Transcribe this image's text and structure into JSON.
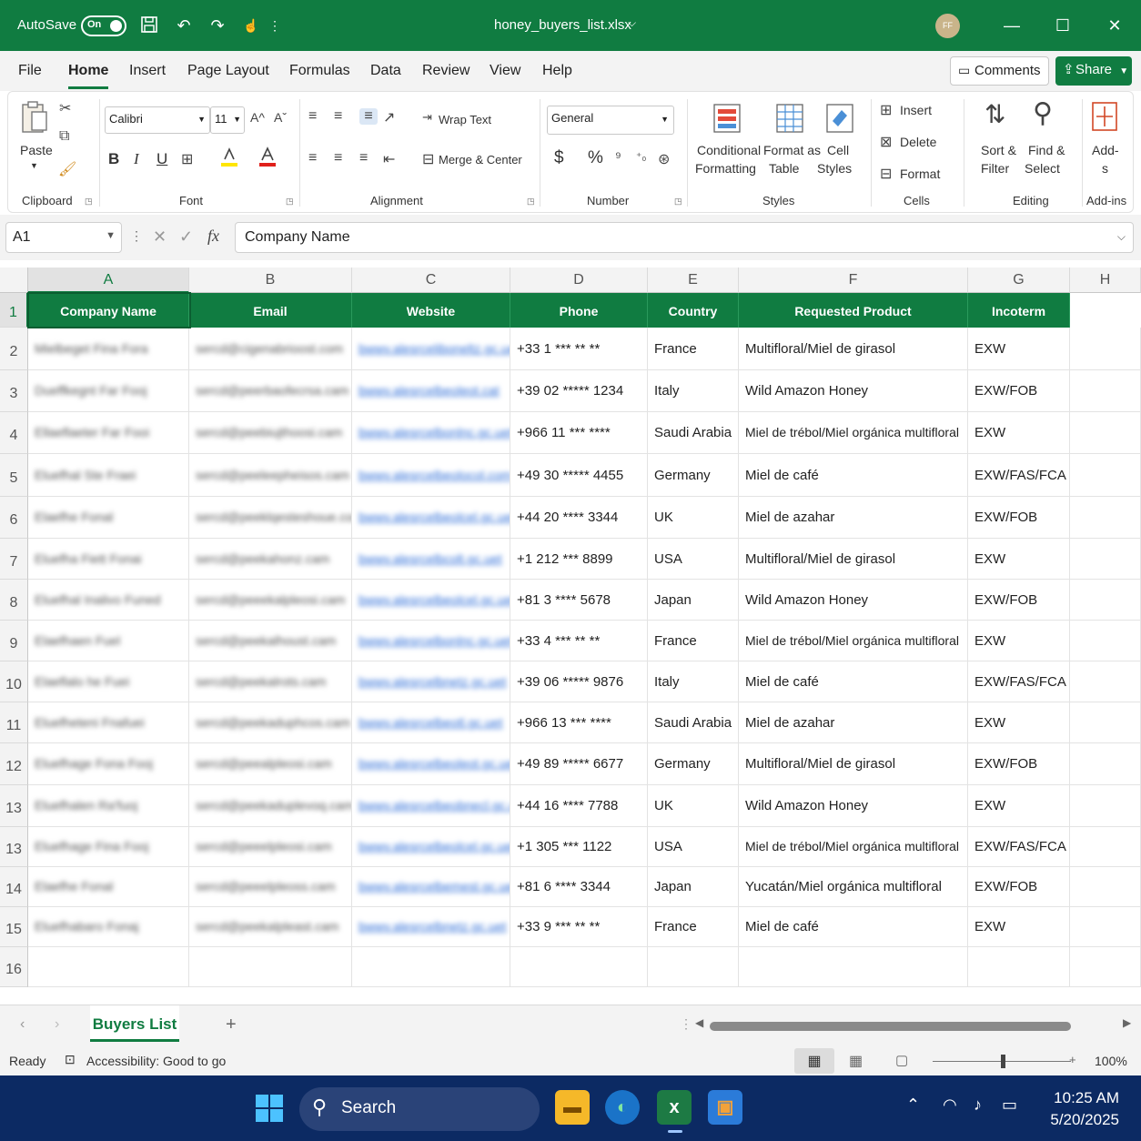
{
  "titlebar": {
    "autosave_label": "AutoSave",
    "toggle_state": "On",
    "filename": "honey_buyers_list.xlsx",
    "avatar_initials": "FF",
    "icons": [
      "save-icon",
      "undo-icon",
      "redo-icon",
      "touch-mode-icon",
      "more-icon"
    ]
  },
  "menu": {
    "tabs": [
      "File",
      "Home",
      "Insert",
      "Page Layout",
      "Formulas",
      "Data",
      "Review",
      "View",
      "Help"
    ],
    "active": "Home",
    "comments_label": "Comments",
    "share_label": "Share"
  },
  "ribbon": {
    "clipboard": {
      "paste": "Paste",
      "label": "Clipboard"
    },
    "font": {
      "name": "Calibri",
      "size": "11",
      "bold": "B",
      "italic": "I",
      "underline": "U",
      "label": "Font"
    },
    "alignment": {
      "wrap": "Wrap Text",
      "merge": "Merge & Center",
      "label": "Alignment"
    },
    "number": {
      "format": "General",
      "currency": "$",
      "percent": "%",
      "label": "Number"
    },
    "styles": {
      "conditional_1": "Conditional",
      "conditional_2": "Formatting",
      "format_as_1": "Format as",
      "format_as_2": "Table",
      "cell_1": "Cell",
      "cell_2": "Styles",
      "label": "Styles"
    },
    "cells": {
      "insert": "Insert",
      "delete": "Delete",
      "format": "Format",
      "label": "Cells"
    },
    "editing": {
      "sort_1": "Sort &",
      "sort_2": "Filter",
      "find_1": "Find &",
      "find_2": "Select",
      "label": "Editing"
    },
    "addins": {
      "label_1": "Add-",
      "label_2": "s",
      "group": "Add-ins"
    }
  },
  "formula_bar": {
    "name_box": "A1",
    "fx": "fx",
    "content": "Company Name"
  },
  "columns": [
    "A",
    "B",
    "C",
    "D",
    "E",
    "F",
    "G",
    "H"
  ],
  "header_row": [
    "Company Name",
    "Email",
    "Website",
    "Phone",
    "Country",
    "Requested Product",
    "Incoterm"
  ],
  "row_numbers": [
    "1",
    "2",
    "3",
    "4",
    "5",
    "6",
    "7",
    "8",
    "9",
    "10",
    "11",
    "12",
    "13",
    "13",
    "14",
    "15",
    "16"
  ],
  "rows": [
    {
      "company": "Mielbeget Fina Fora",
      "email": "sercd@cigenabrioost.com",
      "website": "bwwv.alesrceliboneltz.gc.uet",
      "phone": "+33 1 *** ** **",
      "country": "France",
      "product": "Multifloral/Miel de girasol",
      "incoterm": "EXW"
    },
    {
      "company": "Dueffkegnt Far Fooj",
      "email": "sercd@peerbaofecrsa.cam",
      "website": "bwwv.alesrcelbeoleot.cat",
      "phone": "+39 02 ***** 1234",
      "country": "Italy",
      "product": "Wild Amazon Honey",
      "incoterm": "EXW/FOB"
    },
    {
      "company": "Ellaeflaeter Far Fooi",
      "email": "sercd@peebiujthoosi.cam",
      "website": "bwwv.alesrcelbonlnc.gc.uet",
      "phone": "+966 11 *** ****",
      "country": "Saudi Arabia",
      "product": "Miel de trébol/Miel orgánica multifloral",
      "incoterm": "EXW"
    },
    {
      "company": "Eluefhal Ste Fraei",
      "email": "sercd@peeleepheisos.cam",
      "website": "bwwv.alesrcelbeolocol.com",
      "phone": "+49 30 ***** 4455",
      "country": "Germany",
      "product": "Miel de café",
      "incoterm": "EXW/FAS/FCA"
    },
    {
      "company": "Elaefhe Fonal",
      "email": "sercd@peeklqesteshoue.com",
      "website": "bwwv.alesrcelbeolcel.gc.uet",
      "phone": "+44 20 **** 3344",
      "country": "UK",
      "product": "Miel de azahar",
      "incoterm": "EXW/FOB"
    },
    {
      "company": "Eluefha Fiett Fonai",
      "email": "sercd@peekahonz.cam",
      "website": "bwwv.alesrcelbcolt.gc.uet",
      "phone": "+1 212 *** 8899",
      "country": "USA",
      "product": "Multifloral/Miel de girasol",
      "incoterm": "EXW"
    },
    {
      "company": "Eluefhal Inalivo Funed",
      "email": "sercd@peeekalpleosi.cam",
      "website": "bwwv.alesrcelbeolcel.gc.uet",
      "phone": "+81 3 **** 5678",
      "country": "Japan",
      "product": "Wild Amazon Honey",
      "incoterm": "EXW/FOB"
    },
    {
      "company": "Elaefhaen Fuel",
      "email": "sercd@peekalhoust.cam",
      "website": "bwwv.alesrcelbonlnc.gc.uet",
      "phone": "+33 4 *** ** **",
      "country": "France",
      "product": "Miel de trébol/Miel orgánica multifloral",
      "incoterm": "EXW"
    },
    {
      "company": "Elaeflalo he Fuei",
      "email": "sercd@peekalrots.cam",
      "website": "bwwv.alesrcelbnetz.gc.uet",
      "phone": "+39 06 ***** 9876",
      "country": "Italy",
      "product": "Miel de café",
      "incoterm": "EXW/FAS/FCA"
    },
    {
      "company": "Eluefheteni Fnafuei",
      "email": "sercd@peekaduphcos.cam",
      "website": "bwwv.alesrcelbeotl.gc.uet",
      "phone": "+966 13 *** ****",
      "country": "Saudi Arabia",
      "product": "Miel de azahar",
      "incoterm": "EXW"
    },
    {
      "company": "Eluefhage Fona Fooj",
      "email": "sercd@peealpleosi.cam",
      "website": "bwwv.alesrcelbeoleot.gc.uet",
      "phone": "+49 89 ***** 6677",
      "country": "Germany",
      "product": "Multifloral/Miel de girasol",
      "incoterm": "EXW/FOB"
    },
    {
      "company": "Eluefhalen Ra'fuoj",
      "email": "sercd@peekaduplevoq.cam",
      "website": "bwwv.alesrcelbeobnecl.gc.uet",
      "phone": "+44 16 **** 7788",
      "country": "UK",
      "product": "Wild Amazon Honey",
      "incoterm": "EXW"
    },
    {
      "company": "Eluefhage Fina Fooj",
      "email": "sercd@peeelpleosi.cam",
      "website": "bwwv.alesrcelbeolcel.gc.uet",
      "phone": "+1 305 *** 1122",
      "country": "USA",
      "product": "Miel de trébol/Miel orgánica multifloral",
      "incoterm": "EXW/FAS/FCA"
    },
    {
      "company": "Elaefhe Fonal",
      "email": "sercd@peeelpleoss.cam",
      "website": "bwwv.alesrcelbemest.gc.uet",
      "phone": "+81 6 **** 3344",
      "country": "Japan",
      "product": "Yucatán/Miel orgánica multifloral",
      "incoterm": "EXW/FOB"
    },
    {
      "company": "Eluefhabaro Fonaj",
      "email": "sercd@peekalpleast.cam",
      "website": "bwwv.alesrcelbnetz.gc.uet",
      "phone": "+33 9 *** ** **",
      "country": "France",
      "product": "Miel de café",
      "incoterm": "EXW"
    }
  ],
  "sheet_tabs": {
    "active": "Buyers List",
    "add": "+"
  },
  "statusbar": {
    "ready": "Ready",
    "accessibility": "Accessibility: Good to go",
    "zoom": "100%"
  },
  "taskbar": {
    "search": "Search",
    "time": "10:25 AM",
    "date": "5/20/2025"
  },
  "colors": {
    "accent": "#107c41",
    "taskbar": "#0c2a63"
  }
}
